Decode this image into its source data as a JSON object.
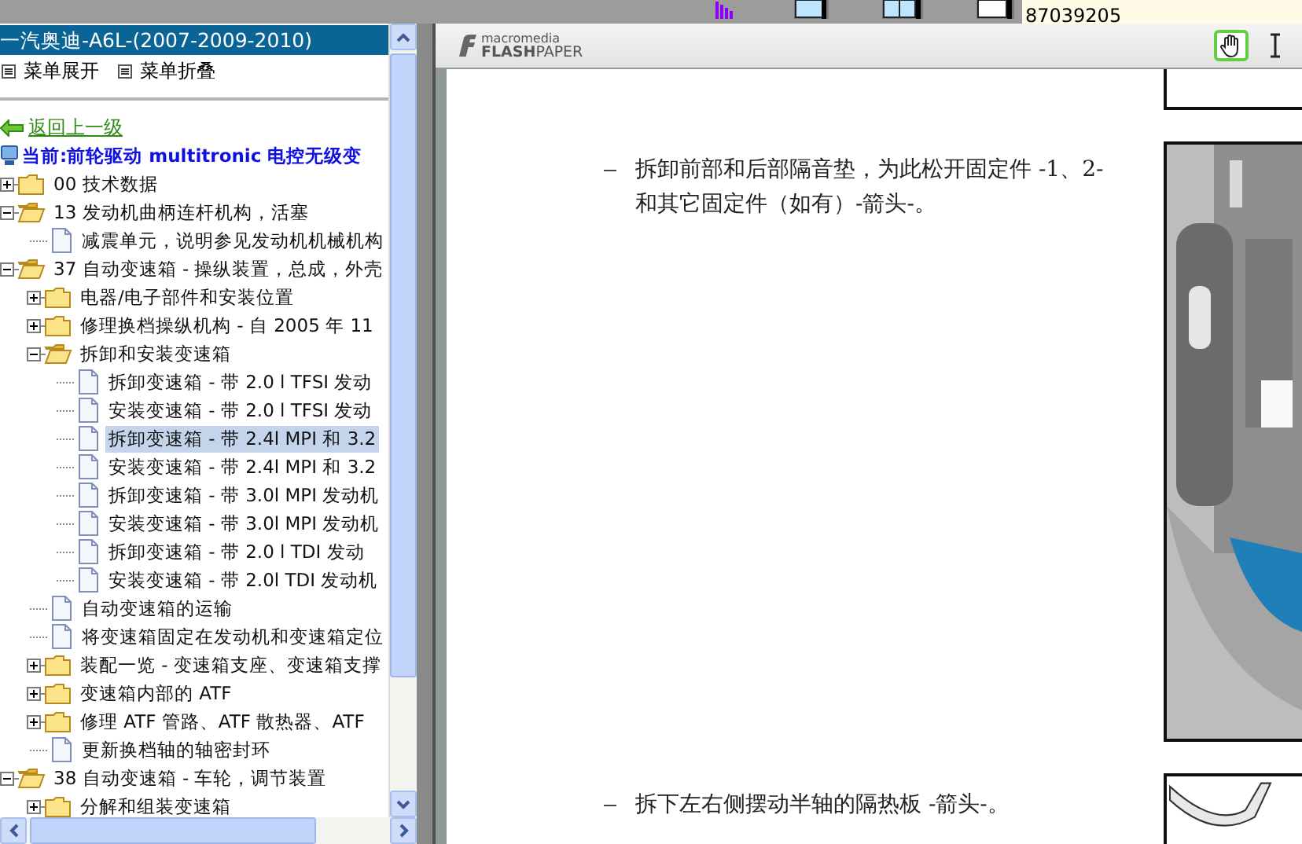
{
  "top_strip": {
    "code": "87039205"
  },
  "sidebar": {
    "title": "一汽奥迪-A6L-(2007-2009-2010)",
    "menu": [
      {
        "label": "菜单展开"
      },
      {
        "label": "菜单折叠"
      }
    ],
    "back_link": "返回上一级",
    "current": "当前:前轮驱动 multitronic 电控无级变",
    "tree": [
      {
        "kind": "folder",
        "label": "00 技术数据",
        "expanded": false,
        "selected": false
      },
      {
        "kind": "folder",
        "label": "13 发动机曲柄连杆机构，活塞",
        "expanded": true,
        "selected": false,
        "children": [
          {
            "kind": "doc",
            "label": "减震单元，说明参见发动机机械机构",
            "selected": false
          }
        ]
      },
      {
        "kind": "folder",
        "label": "37 自动变速箱 - 操纵装置，总成，外壳",
        "expanded": true,
        "selected": false,
        "children": [
          {
            "kind": "folder",
            "label": "电器/电子部件和安装位置",
            "expanded": false,
            "selected": false
          },
          {
            "kind": "folder",
            "label": "修理换档操纵机构 - 自 2005 年 11",
            "expanded": false,
            "selected": false
          },
          {
            "kind": "folder",
            "label": "拆卸和安装变速箱",
            "expanded": true,
            "selected": false,
            "children": [
              {
                "kind": "doc",
                "label": "拆卸变速箱 - 带 2.0 l TFSI 发动",
                "selected": false
              },
              {
                "kind": "doc",
                "label": "安装变速箱 - 带 2.0 l TFSI 发动",
                "selected": false
              },
              {
                "kind": "doc",
                "label": "拆卸变速箱 - 带 2.4l MPI 和 3.2",
                "selected": true
              },
              {
                "kind": "doc",
                "label": "安装变速箱 - 带 2.4l MPI 和 3.2",
                "selected": false
              },
              {
                "kind": "doc",
                "label": "拆卸变速箱 - 带 3.0l MPI 发动机",
                "selected": false
              },
              {
                "kind": "doc",
                "label": "安装变速箱 - 带 3.0l MPI 发动机",
                "selected": false
              },
              {
                "kind": "doc",
                "label": "拆卸变速箱 - 带 2.0 l TDI 发动",
                "selected": false
              },
              {
                "kind": "doc",
                "label": "安装变速箱 - 带 2.0l TDI 发动机",
                "selected": false
              }
            ]
          },
          {
            "kind": "doc",
            "label": "自动变速箱的运输",
            "selected": false
          },
          {
            "kind": "doc",
            "label": "将变速箱固定在发动机和变速箱定位",
            "selected": false
          },
          {
            "kind": "folder",
            "label": "装配一览 - 变速箱支座、变速箱支撑",
            "expanded": false,
            "selected": false
          },
          {
            "kind": "folder",
            "label": "变速箱内部的 ATF",
            "expanded": false,
            "selected": false
          },
          {
            "kind": "folder",
            "label": "修理 ATF 管路、ATF 散热器、ATF",
            "expanded": false,
            "selected": false
          },
          {
            "kind": "doc",
            "label": "更新换档轴的轴密封环",
            "selected": false
          }
        ]
      },
      {
        "kind": "folder",
        "label": "38 自动变速箱 - 车轮，调节装置",
        "expanded": true,
        "selected": false,
        "children": [
          {
            "kind": "folder",
            "label": "分解和组装变速箱",
            "expanded": false,
            "selected": false
          }
        ]
      }
    ]
  },
  "viewer": {
    "logo_top": "macromedia",
    "logo_name": "**FLASH**PAPER",
    "tools": [
      {
        "kind": "hand",
        "selected": true
      },
      {
        "kind": "text",
        "selected": false
      }
    ],
    "steps": [
      "拆卸前部和后部隔音垫，为此松开固定件 -1、2- 和其它固定件（如有）-箭头-。",
      "拆下左右侧摆动半轴的隔热板 -箭头-。"
    ]
  }
}
